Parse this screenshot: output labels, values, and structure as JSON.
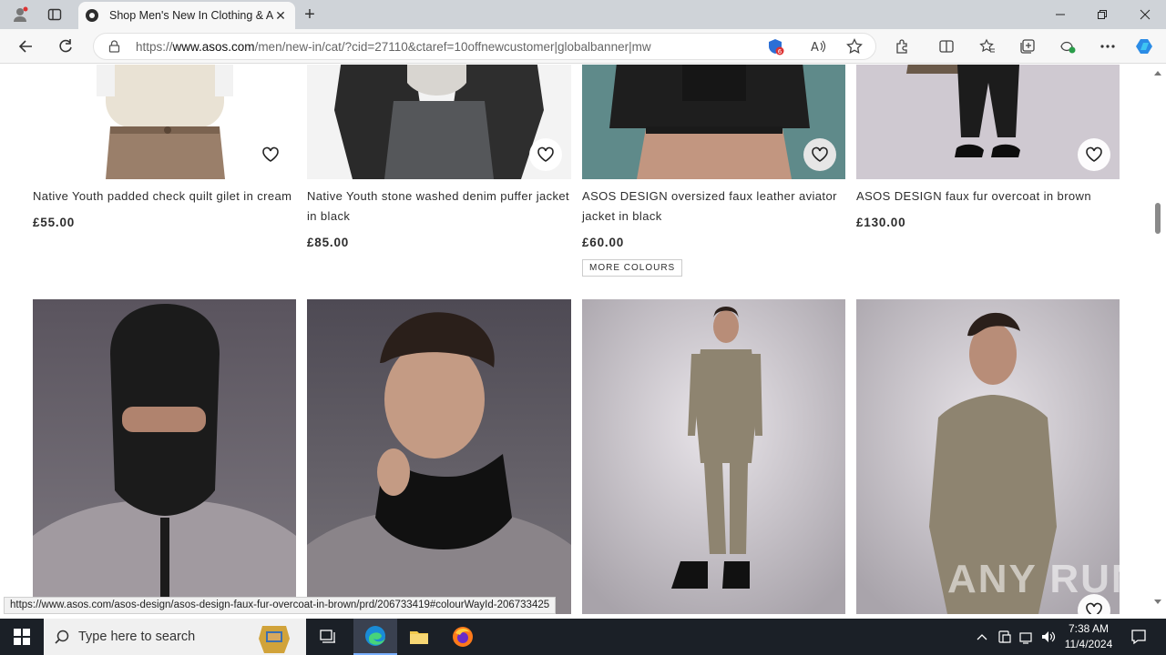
{
  "browser": {
    "tab_title": "Shop Men's New In Clothing & A",
    "url_prefix": "https://",
    "url_host": "www.asos.com",
    "url_path": "/men/new-in/cat/?cid=27110&ctaref=10offnewcustomer|globalbanner|mw",
    "status_url": "https://www.asos.com/asos-design/asos-design-faux-fur-overcoat-in-brown/prd/206733419#colourWayId-206733425"
  },
  "products_row1": [
    {
      "name": "Native Youth padded check quilt gilet in cream",
      "price": "£55.00"
    },
    {
      "name": "Native Youth stone washed denim puffer jacket in black",
      "price": "£85.00"
    },
    {
      "name": "ASOS DESIGN oversized faux leather aviator jacket in black",
      "price": "£60.00",
      "more": "MORE COLOURS"
    },
    {
      "name": "ASOS DESIGN faux fur overcoat in brown",
      "price": "£130.00"
    }
  ],
  "watermark": "ANY RUN",
  "taskbar": {
    "search_placeholder": "Type here to search",
    "time": "7:38 AM",
    "date": "11/4/2024"
  },
  "colors": {
    "accent": "#2d2d2d",
    "taskbar": "#1b2027"
  }
}
